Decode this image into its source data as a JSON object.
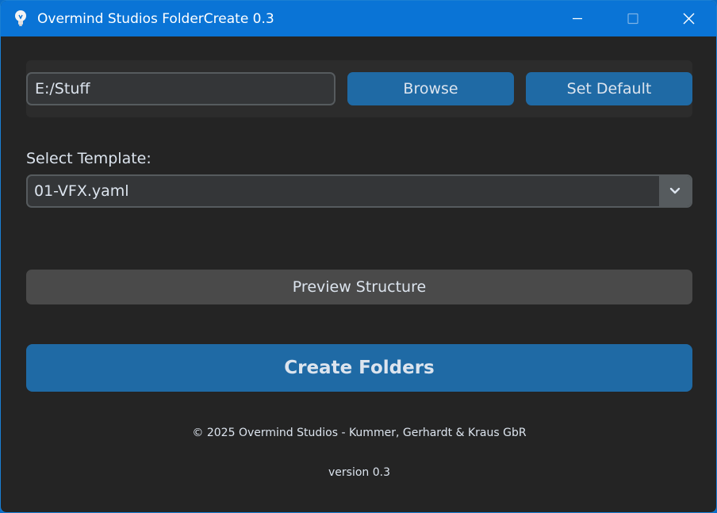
{
  "window": {
    "title": "Overmind Studios FolderCreate 0.3",
    "app_icon": "lightbulb-icon"
  },
  "titlebar_controls": {
    "minimize_icon": "minimize-icon",
    "maximize_icon": "maximize-icon",
    "close_icon": "close-icon"
  },
  "path_row": {
    "path_value": "E:/Stuff",
    "browse_label": "Browse",
    "set_default_label": "Set Default"
  },
  "template": {
    "label": "Select Template:",
    "selected": "01-VFX.yaml",
    "dropdown_icon": "chevron-down-icon"
  },
  "actions": {
    "preview_label": "Preview Structure",
    "create_label": "Create Folders"
  },
  "footer": {
    "copyright": "© 2025 Overmind Studios - Kummer, Gerhardt & Kraus GbR",
    "version": "version 0.3"
  },
  "colors": {
    "titlebar": "#0a74d6",
    "background": "#242424",
    "accent_button": "#1f6aa5",
    "secondary_button": "#4a4a4a",
    "input_bg": "#343638",
    "input_border": "#565b5e",
    "text": "#dce4ee"
  }
}
